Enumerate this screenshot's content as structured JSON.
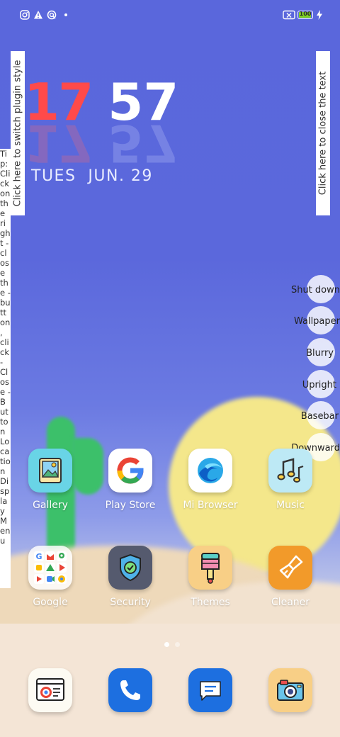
{
  "status_bar": {
    "left_icons": [
      "instagram-icon",
      "warning-icon",
      "sync-icon",
      "dot-icon"
    ],
    "right_icons": [
      "sim-off-icon",
      "battery-icon",
      "charging-icon"
    ],
    "battery_level": "100",
    "battery_color": "#7ed321"
  },
  "widget": {
    "switch_style_label": "Click here to switch plugin style",
    "close_text_label": "Click here to close the text",
    "hour": "17",
    "minute": "57",
    "date": "TUES  JUN. 29",
    "hour_color": "#ff4a4a"
  },
  "tip_text": "Tip: Click on the right - close the - button, click - Close - Button Location Display Menu",
  "menu": [
    {
      "label": "Shut down"
    },
    {
      "label": "Wallpaper"
    },
    {
      "label": "Blurry"
    },
    {
      "label": "Upright"
    },
    {
      "label": "Basebar"
    },
    {
      "label": "Downward"
    }
  ],
  "apps_row1": [
    {
      "label": "Gallery",
      "icon": "gallery-icon"
    },
    {
      "label": "Play Store",
      "icon": "play-store-icon"
    },
    {
      "label": "Mi Browser",
      "icon": "mi-browser-icon"
    },
    {
      "label": "Music",
      "icon": "music-icon"
    }
  ],
  "apps_row2": [
    {
      "label": "Google",
      "icon": "google-folder-icon"
    },
    {
      "label": "Security",
      "icon": "security-icon"
    },
    {
      "label": "Themes",
      "icon": "themes-icon"
    },
    {
      "label": "Cleaner",
      "icon": "cleaner-icon"
    }
  ],
  "dock": [
    {
      "icon": "chrome-app-icon"
    },
    {
      "icon": "phone-icon"
    },
    {
      "icon": "messages-icon"
    },
    {
      "icon": "camera-icon"
    }
  ],
  "page_indicator": {
    "pages": 2,
    "current": 1
  }
}
